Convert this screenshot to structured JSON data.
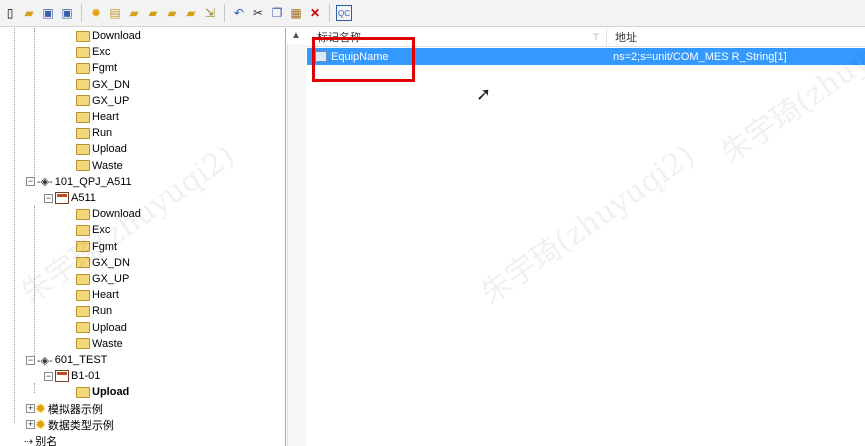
{
  "toolbar": {
    "icons": [
      "new-icon",
      "open-icon",
      "save-icon",
      "save-as-icon",
      "settings-gear-icon",
      "properties-icon",
      "new-channel-icon",
      "new-device-icon",
      "new-group-icon",
      "new-tag-icon",
      "export-icon",
      "undo-icon",
      "cut-icon",
      "copy-icon",
      "paste-icon",
      "delete-icon",
      "quick-client-icon"
    ]
  },
  "tree": {
    "group1_items": [
      "Download",
      "Exc",
      "Fgmt",
      "GX_DN",
      "GX_UP",
      "Heart",
      "Run",
      "Upload",
      "Waste"
    ],
    "channel2": "101_QPJ_A511",
    "device2": "A511",
    "group2_items": [
      "Download",
      "Exc",
      "Fgmt",
      "GX_DN",
      "GX_UP",
      "Heart",
      "Run",
      "Upload",
      "Waste"
    ],
    "channel3": "601_TEST",
    "device3": "B1-01",
    "group3_items": [
      "Upload"
    ],
    "simulator": "模拟器示例",
    "datatype": "数据类型示例",
    "alias": "别名"
  },
  "list": {
    "col_name": "标记名称",
    "col_addr": "地址",
    "rows": [
      {
        "name": "EquipName",
        "address": "ns=2;s=unit/COM_MES R_String[1]"
      }
    ]
  },
  "watermark": "朱宇琦(zhuyuqi2)",
  "colors": {
    "selection": "#3399ff",
    "highlight": "#e00000"
  }
}
